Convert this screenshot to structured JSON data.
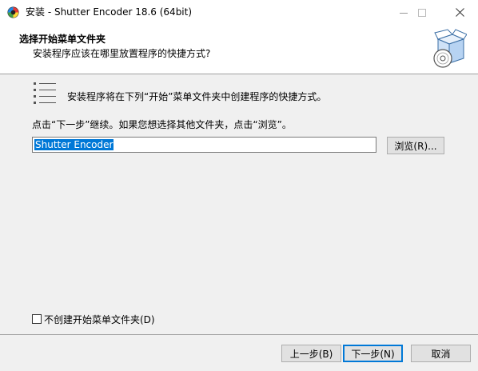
{
  "window": {
    "title": "安装 - Shutter Encoder 18.6 (64bit)"
  },
  "header": {
    "title": "选择开始菜单文件夹",
    "subtitle": "安装程序应该在哪里放置程序的快捷方式?"
  },
  "body": {
    "intro": "安装程序将在下列“开始”菜单文件夹中创建程序的快捷方式。",
    "instruction": "点击“下一步”继续。如果您想选择其他文件夹，点击“浏览”。",
    "folder_value": "Shutter Encoder",
    "browse_label": "浏览(R)..."
  },
  "options": {
    "no_start_menu_label": "不创建开始菜单文件夹(D)",
    "no_start_menu_checked": false
  },
  "footer": {
    "back_label": "上一步(B)",
    "next_label": "下一步(N)",
    "cancel_label": "取消"
  },
  "colors": {
    "selection": "#0078d7",
    "face": "#f0f0f0",
    "header_bg": "#ffffff"
  },
  "icons": {
    "app": "shutter-encoder-app-icon",
    "minimize": "minimize-icon",
    "maximize": "maximize-icon",
    "close": "close-icon",
    "header": "installer-box-disc-icon",
    "list": "list-icon"
  }
}
